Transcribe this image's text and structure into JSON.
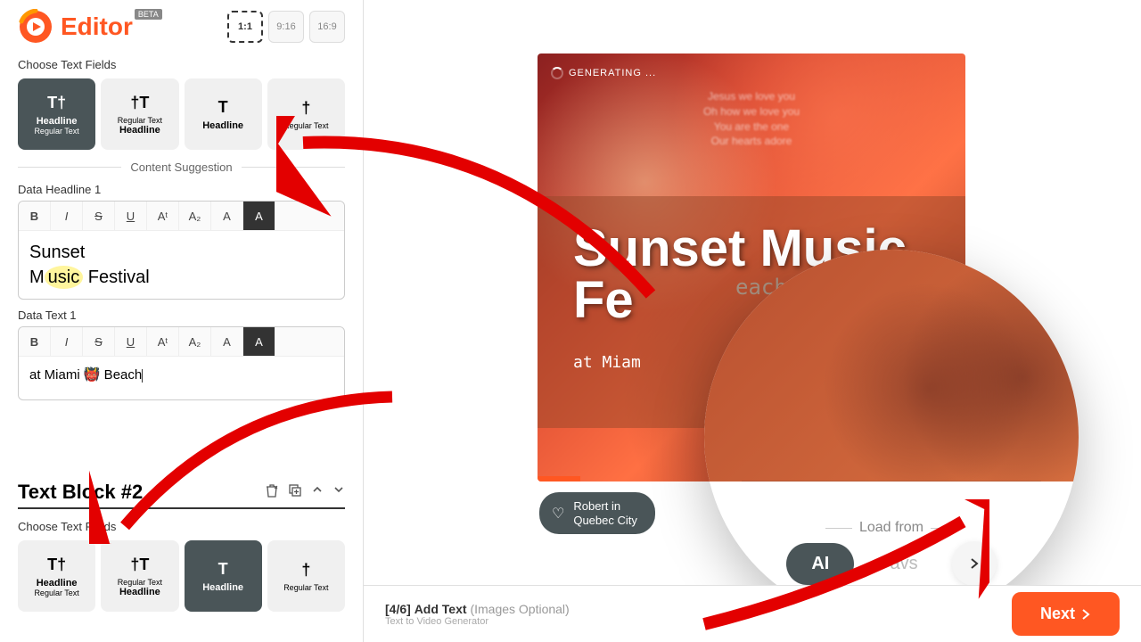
{
  "header": {
    "logo_text": "Editor",
    "beta_label": "BETA",
    "ratios": [
      "1:1",
      "9:16",
      "16:9"
    ],
    "active_ratio": 0
  },
  "block1": {
    "choose_label": "Choose Text Fields",
    "field_types": [
      {
        "icon": "T†",
        "l1": "Headline",
        "l2": "Regular Text"
      },
      {
        "icon": "†T",
        "l1": "Regular Text",
        "l2": "Headline"
      },
      {
        "icon": "T",
        "l1": "Headline",
        "l2": ""
      },
      {
        "icon": "†",
        "l1": "Regular Text",
        "l2": ""
      }
    ],
    "active_field_type": 0,
    "content_suggestion_label": "Content Suggestion",
    "headline_label": "Data Headline 1",
    "headline_value_pre": "Sunset\nM",
    "headline_value_hl": "usic",
    "headline_value_post": " Festival",
    "text_label": "Data Text 1",
    "text_value": "at Miami 👹 Beach"
  },
  "toolbar_buttons": [
    "B",
    "I",
    "S",
    "U",
    "Aᵗ",
    "A₂",
    "A",
    "A"
  ],
  "block2": {
    "title": "Text Block #2",
    "choose_label": "Choose Text Fields"
  },
  "preview": {
    "generating_label": "GENERATING ...",
    "headline": "Sunset Music Fe",
    "beach_text": "each",
    "subtext": "at Miam",
    "lyrics": "Jesus we love you\nOh how we love you\nYou are the one\nOur hearts adore"
  },
  "user_pill": {
    "name": "Robert in",
    "location": "Quebec City"
  },
  "magnifier": {
    "load_label": "Load from",
    "ai_label": "AI",
    "favs_label": "Favs"
  },
  "footer": {
    "step_counter": "[4/6]",
    "step_title": "Add Text",
    "step_optional": "(Images Optional)",
    "subtitle": "Text to Video Generator",
    "next_label": "Next"
  },
  "colors": {
    "accent": "#ff5722",
    "dark_block": "#4a5558"
  }
}
